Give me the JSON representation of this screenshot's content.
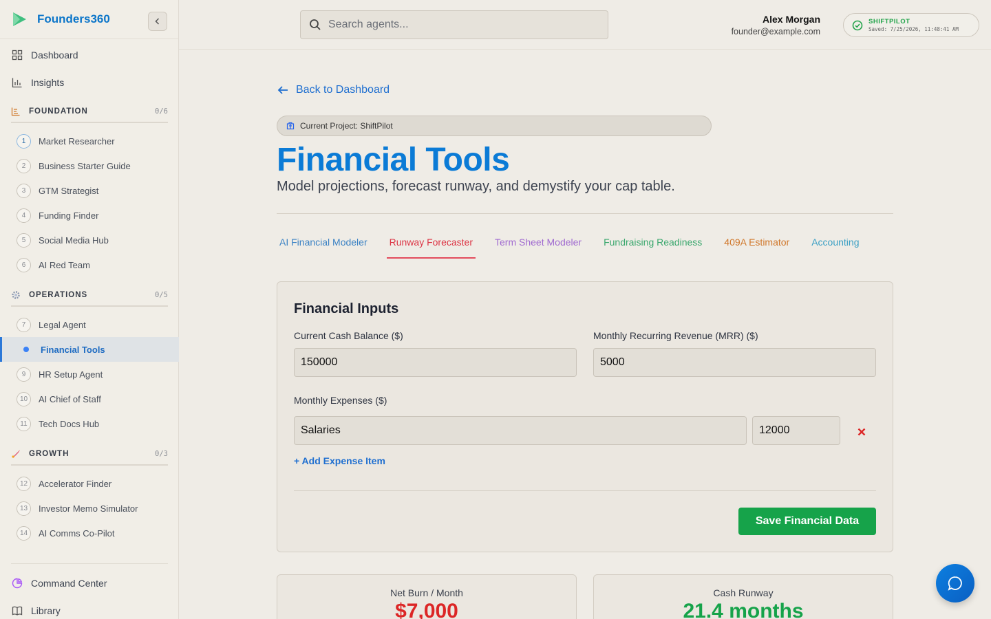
{
  "brand": {
    "name": "Founders360"
  },
  "nav": {
    "dashboard": "Dashboard",
    "insights": "Insights",
    "command_center": "Command Center",
    "library": "Library"
  },
  "sections": [
    {
      "title": "FOUNDATION",
      "count": "0/6",
      "items": [
        {
          "num": "1",
          "label": "Market Researcher"
        },
        {
          "num": "2",
          "label": "Business Starter Guide"
        },
        {
          "num": "3",
          "label": "GTM Strategist"
        },
        {
          "num": "4",
          "label": "Funding Finder"
        },
        {
          "num": "5",
          "label": "Social Media Hub"
        },
        {
          "num": "6",
          "label": "AI Red Team"
        }
      ]
    },
    {
      "title": "OPERATIONS",
      "count": "0/5",
      "items": [
        {
          "num": "7",
          "label": "Legal Agent"
        },
        {
          "num": "",
          "label": "Financial Tools",
          "active": true
        },
        {
          "num": "9",
          "label": "HR Setup Agent"
        },
        {
          "num": "10",
          "label": "AI Chief of Staff"
        },
        {
          "num": "11",
          "label": "Tech Docs Hub"
        }
      ]
    },
    {
      "title": "GROWTH",
      "count": "0/3",
      "items": [
        {
          "num": "12",
          "label": "Accelerator Finder"
        },
        {
          "num": "13",
          "label": "Investor Memo Simulator"
        },
        {
          "num": "14",
          "label": "AI Comms Co-Pilot"
        }
      ]
    }
  ],
  "header": {
    "search_placeholder": "Search agents...",
    "user_name": "Alex Morgan",
    "user_email": "founder@example.com",
    "saved_project": "SHIFTPILOT",
    "saved_time": "Saved: 7/25/2026, 11:48:41 AM"
  },
  "page": {
    "back_label": "Back to Dashboard",
    "project_pill": "Current Project: ShiftPilot",
    "title": "Financial Tools",
    "subtitle": "Model projections, forecast runway, and demystify your cap table.",
    "tabs": [
      {
        "label": "AI Financial Modeler",
        "color": "#3b82c4"
      },
      {
        "label": "Runway Forecaster",
        "color": "#dc3545",
        "active": true
      },
      {
        "label": "Term Sheet Modeler",
        "color": "#a06ad0"
      },
      {
        "label": "Fundraising Readiness",
        "color": "#3aa76d"
      },
      {
        "label": "409A Estimator",
        "color": "#d0772a"
      },
      {
        "label": "Accounting",
        "color": "#3a9fc4"
      }
    ]
  },
  "inputs": {
    "title": "Financial Inputs",
    "cash_label": "Current Cash Balance ($)",
    "cash_value": "150000",
    "mrr_label": "Monthly Recurring Revenue (MRR) ($)",
    "mrr_value": "5000",
    "expenses_label": "Monthly Expenses ($)",
    "expense_name": "Salaries",
    "expense_amount": "12000",
    "add_expense": "+ Add Expense Item",
    "save_label": "Save Financial Data"
  },
  "metrics": {
    "burn_label": "Net Burn / Month",
    "burn_value": "$7,000",
    "burn_color": "#dc2626",
    "runway_label": "Cash Runway",
    "runway_value": "21.4 months",
    "runway_color": "#16a34a"
  }
}
